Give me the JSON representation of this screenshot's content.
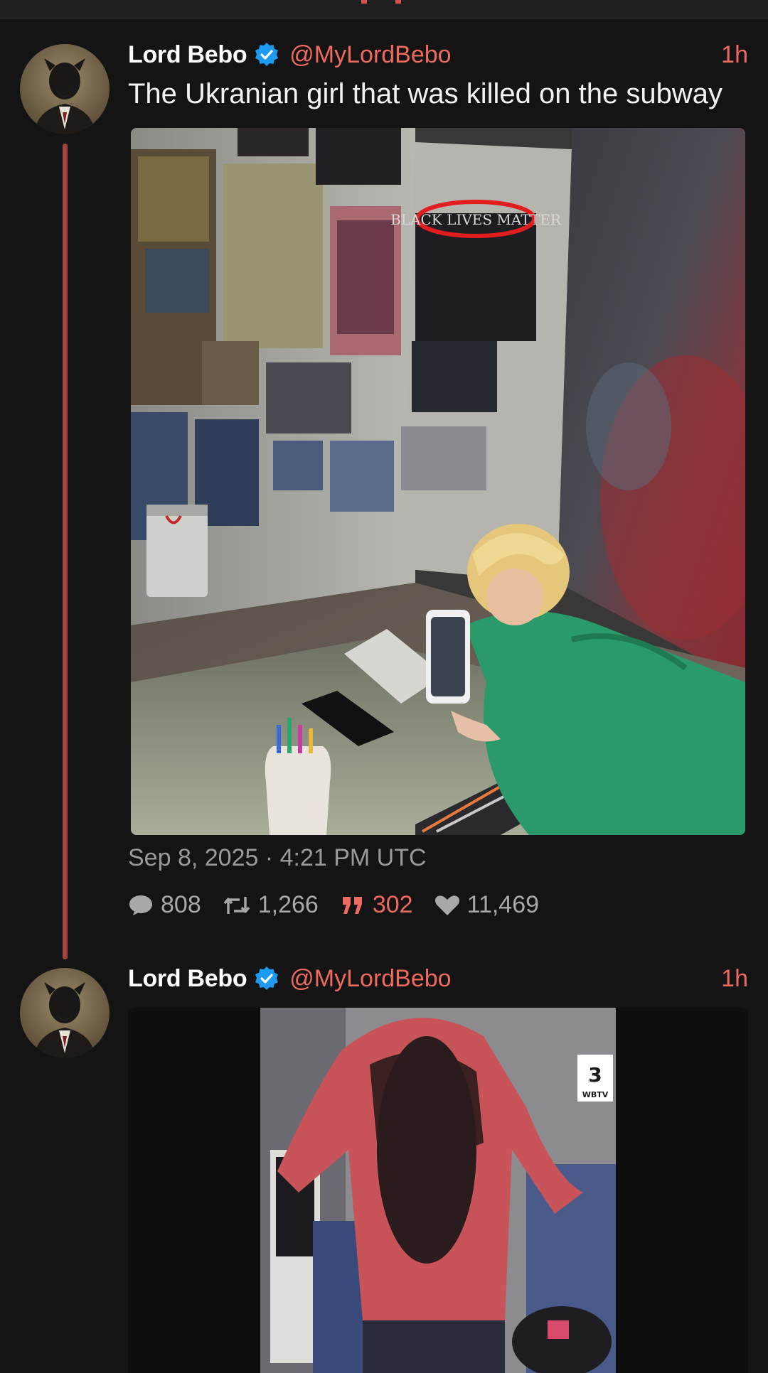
{
  "tweets": [
    {
      "name": "Lord Bebo",
      "handle": "@MyLordBebo",
      "time": "1h",
      "text": "The Ukranian girl that was killed on the subway",
      "date": "Sep 8, 2025 · 4:21 PM UTC",
      "stats": {
        "comments": "808",
        "retweets": "1,266",
        "quotes": "302",
        "likes": "11,469"
      },
      "photo_overlay_text": "BLACK LIVES MATTER"
    },
    {
      "name": "Lord Bebo",
      "handle": "@MyLordBebo",
      "time": "1h",
      "video_watermark": "WBTV"
    }
  ],
  "icons": {
    "verified": "verified-badge-icon",
    "comment": "comment-icon",
    "retweet": "retweet-icon",
    "quote": "quote-icon",
    "like": "heart-icon"
  },
  "colors": {
    "accent": "#ee6a5e",
    "thread_line": "#a8423e",
    "verified": "#1d9bf0",
    "background": "#141414"
  }
}
